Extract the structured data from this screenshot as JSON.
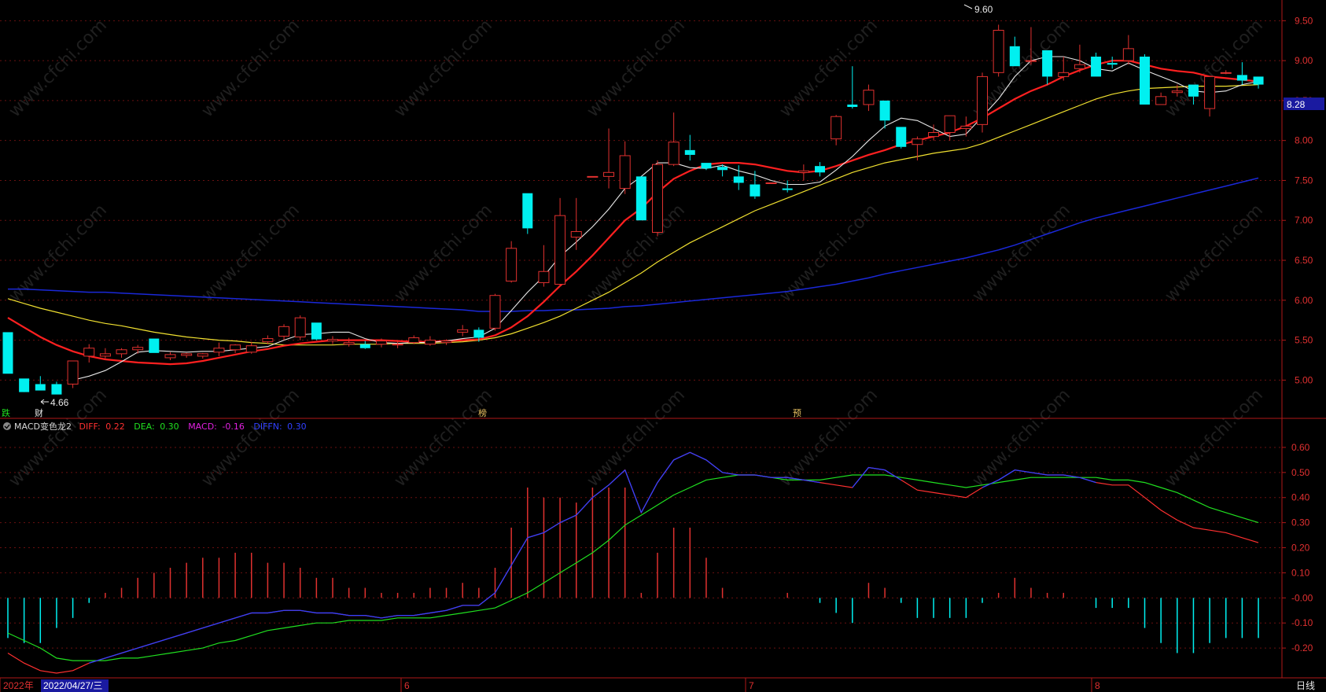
{
  "chart_data": {
    "type": "candlestick",
    "timeframe_label": "日线",
    "colors": {
      "up": "#e0312f",
      "down": "#00f0f0",
      "ma5": "#e8e8e8",
      "ma10": "#ff2020",
      "ma20": "#f0e030",
      "ma60": "#1a28d8",
      "diff": "#ff3030",
      "dea": "#20e020",
      "macd_label": "#e020e0",
      "diffn": "#3040ff",
      "axis": "#b01818",
      "price_box": "#1a1aa0"
    },
    "price_axis": {
      "ylim": [
        4.6,
        9.7
      ],
      "ticks": [
        "9.50",
        "9.00",
        "8.50",
        "8.00",
        "7.50",
        "7.00",
        "6.50",
        "6.00",
        "5.50",
        "5.00"
      ]
    },
    "macd_axis": {
      "ylim": [
        -0.3,
        0.65
      ],
      "ticks": [
        "0.60",
        "0.50",
        "0.40",
        "0.30",
        "0.20",
        "0.10",
        "-0.00",
        "-0.10",
        "-0.20"
      ]
    },
    "current_price": "8.28",
    "annotations": {
      "high": "9.60",
      "low": "4.66"
    },
    "markers": [
      "跌",
      "财",
      "榜",
      "预"
    ],
    "x_labels": {
      "year": "2022年",
      "cursor_date": "2022/04/27/三",
      "months": [
        "6",
        "7",
        "8"
      ]
    },
    "indicator": {
      "name": "MACD变色龙2",
      "fields": [
        {
          "label": "DIFF:",
          "value": "0.22"
        },
        {
          "label": "DEA:",
          "value": "0.30"
        },
        {
          "label": "MACD:",
          "value": "-0.16"
        },
        {
          "label": "DIFFN:",
          "value": "0.30"
        }
      ]
    },
    "watermark": "www.cfchi.com",
    "candles": [
      [
        5.6,
        5.6,
        5.08,
        5.08
      ],
      [
        5.02,
        5.02,
        4.9,
        4.85
      ],
      [
        4.95,
        5.05,
        4.87,
        4.87
      ],
      [
        4.95,
        4.98,
        4.82,
        4.82
      ],
      [
        4.95,
        5.24,
        4.9,
        5.24
      ],
      [
        5.3,
        5.45,
        5.22,
        5.4
      ],
      [
        5.3,
        5.4,
        5.27,
        5.33
      ],
      [
        5.33,
        5.4,
        5.28,
        5.38
      ],
      [
        5.38,
        5.44,
        5.33,
        5.41
      ],
      [
        5.52,
        5.52,
        5.34,
        5.34
      ],
      [
        5.28,
        5.35,
        5.25,
        5.32
      ],
      [
        5.31,
        5.34,
        5.28,
        5.33
      ],
      [
        5.3,
        5.34,
        5.27,
        5.33
      ],
      [
        5.35,
        5.47,
        5.3,
        5.4
      ],
      [
        5.38,
        5.45,
        5.34,
        5.44
      ],
      [
        5.35,
        5.48,
        5.33,
        5.43
      ],
      [
        5.48,
        5.56,
        5.45,
        5.52
      ],
      [
        5.55,
        5.7,
        5.5,
        5.67
      ],
      [
        5.54,
        5.81,
        5.5,
        5.78
      ],
      [
        5.72,
        5.72,
        5.5,
        5.51
      ],
      [
        5.49,
        5.55,
        5.45,
        5.51
      ],
      [
        5.45,
        5.53,
        5.42,
        5.47
      ],
      [
        5.45,
        5.49,
        5.39,
        5.4
      ],
      [
        5.45,
        5.52,
        5.41,
        5.49
      ],
      [
        5.45,
        5.5,
        5.4,
        5.45
      ],
      [
        5.47,
        5.56,
        5.45,
        5.53
      ],
      [
        5.45,
        5.55,
        5.43,
        5.5
      ],
      [
        5.47,
        5.51,
        5.44,
        5.49
      ],
      [
        5.6,
        5.69,
        5.55,
        5.63
      ],
      [
        5.63,
        5.66,
        5.48,
        5.53
      ],
      [
        5.65,
        6.08,
        5.62,
        6.06
      ],
      [
        6.24,
        6.74,
        6.22,
        6.65
      ],
      [
        7.34,
        7.34,
        6.83,
        6.9
      ],
      [
        6.22,
        6.69,
        6.17,
        6.36
      ],
      [
        6.2,
        7.28,
        6.18,
        7.06
      ],
      [
        6.79,
        7.28,
        6.63,
        6.86
      ],
      [
        7.55,
        7.55,
        7.55,
        7.55
      ],
      [
        7.55,
        8.15,
        7.4,
        7.6
      ],
      [
        7.4,
        7.99,
        7.33,
        7.81
      ],
      [
        7.55,
        7.55,
        7.0,
        7.0
      ],
      [
        6.85,
        7.75,
        6.8,
        7.7
      ],
      [
        7.7,
        8.35,
        7.68,
        7.98
      ],
      [
        7.88,
        8.07,
        7.75,
        7.82
      ],
      [
        7.72,
        7.72,
        7.63,
        7.65
      ],
      [
        7.67,
        7.7,
        7.55,
        7.63
      ],
      [
        7.55,
        7.69,
        7.38,
        7.47
      ],
      [
        7.45,
        7.62,
        7.27,
        7.3
      ],
      [
        7.47,
        7.47,
        7.47,
        7.47
      ],
      [
        7.4,
        7.5,
        7.35,
        7.38
      ],
      [
        7.6,
        7.7,
        7.5,
        7.62
      ],
      [
        7.68,
        7.73,
        7.55,
        7.6
      ],
      [
        8.02,
        8.32,
        7.94,
        8.3
      ],
      [
        8.45,
        8.93,
        8.4,
        8.42
      ],
      [
        8.45,
        8.7,
        8.37,
        8.63
      ],
      [
        8.5,
        8.5,
        8.15,
        8.25
      ],
      [
        8.17,
        8.17,
        7.9,
        7.92
      ],
      [
        7.95,
        8.05,
        7.75,
        8.02
      ],
      [
        8.05,
        8.2,
        8.0,
        8.1
      ],
      [
        8.1,
        8.31,
        8.0,
        8.31
      ],
      [
        8.15,
        8.3,
        8.05,
        8.18
      ],
      [
        8.2,
        8.85,
        8.1,
        8.8
      ],
      [
        8.85,
        9.45,
        8.8,
        9.38
      ],
      [
        9.18,
        9.3,
        8.93,
        8.93
      ],
      [
        9.0,
        9.42,
        8.95,
        9.0
      ],
      [
        9.13,
        9.13,
        8.7,
        8.8
      ],
      [
        8.8,
        9.05,
        8.75,
        8.85
      ],
      [
        8.9,
        9.2,
        8.85,
        8.95
      ],
      [
        9.05,
        9.1,
        8.8,
        8.8
      ],
      [
        8.97,
        9.05,
        8.9,
        8.95
      ],
      [
        9.0,
        9.32,
        8.95,
        9.15
      ],
      [
        9.05,
        9.08,
        8.45,
        8.45
      ],
      [
        8.45,
        8.6,
        8.45,
        8.55
      ],
      [
        8.6,
        8.7,
        8.55,
        8.62
      ],
      [
        8.7,
        8.7,
        8.45,
        8.55
      ],
      [
        8.4,
        8.8,
        8.3,
        8.8
      ],
      [
        8.85,
        8.88,
        8.83,
        8.85
      ],
      [
        8.82,
        8.98,
        8.7,
        8.75
      ],
      [
        8.8,
        8.8,
        8.65,
        8.7
      ]
    ],
    "ma5": [
      null,
      null,
      null,
      null,
      5.0,
      5.05,
      5.12,
      5.23,
      5.35,
      5.37,
      5.36,
      5.35,
      5.36,
      5.36,
      5.38,
      5.4,
      5.42,
      5.5,
      5.57,
      5.58,
      5.6,
      5.6,
      5.52,
      5.47,
      5.46,
      5.47,
      5.47,
      5.49,
      5.52,
      5.54,
      5.65,
      5.87,
      6.1,
      6.3,
      6.55,
      6.73,
      6.92,
      7.14,
      7.4,
      7.55,
      7.72,
      7.72,
      7.66,
      7.65,
      7.69,
      7.62,
      7.57,
      7.5,
      7.45,
      7.45,
      7.48,
      7.63,
      7.8,
      8.0,
      8.18,
      8.28,
      8.25,
      8.15,
      8.05,
      8.08,
      8.3,
      8.52,
      8.8,
      9.0,
      9.05,
      9.05,
      9.0,
      8.9,
      8.87,
      8.97,
      8.88,
      8.8,
      8.72,
      8.62,
      8.6,
      8.62,
      8.7,
      8.74
    ],
    "ma10": [
      5.78,
      5.66,
      5.54,
      5.44,
      5.36,
      5.3,
      5.26,
      5.24,
      5.22,
      5.21,
      5.2,
      5.21,
      5.24,
      5.28,
      5.32,
      5.36,
      5.39,
      5.43,
      5.46,
      5.48,
      5.5,
      5.5,
      5.5,
      5.5,
      5.49,
      5.48,
      5.48,
      5.49,
      5.5,
      5.51,
      5.56,
      5.66,
      5.8,
      5.98,
      6.18,
      6.36,
      6.56,
      6.78,
      7.0,
      7.15,
      7.35,
      7.52,
      7.62,
      7.7,
      7.72,
      7.72,
      7.7,
      7.66,
      7.62,
      7.6,
      7.62,
      7.68,
      7.75,
      7.82,
      7.88,
      7.95,
      8.0,
      8.05,
      8.1,
      8.18,
      8.28,
      8.4,
      8.52,
      8.62,
      8.7,
      8.8,
      8.88,
      8.95,
      9.0,
      9.0,
      8.95,
      8.9,
      8.87,
      8.85,
      8.8,
      8.78,
      8.76,
      8.74
    ],
    "ma20": [
      6.02,
      5.96,
      5.9,
      5.85,
      5.8,
      5.75,
      5.71,
      5.68,
      5.64,
      5.6,
      5.57,
      5.54,
      5.52,
      5.5,
      5.49,
      5.47,
      5.46,
      5.44,
      5.44,
      5.44,
      5.44,
      5.45,
      5.45,
      5.45,
      5.46,
      5.46,
      5.46,
      5.47,
      5.48,
      5.5,
      5.53,
      5.58,
      5.65,
      5.72,
      5.8,
      5.9,
      6.0,
      6.1,
      6.22,
      6.34,
      6.48,
      6.6,
      6.72,
      6.82,
      6.92,
      7.02,
      7.12,
      7.2,
      7.28,
      7.36,
      7.44,
      7.52,
      7.6,
      7.66,
      7.72,
      7.76,
      7.8,
      7.84,
      7.87,
      7.9,
      7.96,
      8.04,
      8.12,
      8.2,
      8.28,
      8.36,
      8.44,
      8.52,
      8.58,
      8.62,
      8.65,
      8.66,
      8.67,
      8.68,
      8.68,
      8.68,
      8.69,
      8.7
    ],
    "ma60": [
      6.14,
      6.14,
      6.13,
      6.12,
      6.11,
      6.1,
      6.1,
      6.09,
      6.08,
      6.07,
      6.06,
      6.05,
      6.04,
      6.03,
      6.02,
      6.01,
      6.0,
      5.99,
      5.98,
      5.97,
      5.96,
      5.95,
      5.94,
      5.93,
      5.92,
      5.91,
      5.9,
      5.89,
      5.88,
      5.86,
      5.86,
      5.86,
      5.87,
      5.87,
      5.88,
      5.88,
      5.89,
      5.9,
      5.92,
      5.93,
      5.95,
      5.97,
      5.99,
      6.01,
      6.03,
      6.05,
      6.07,
      6.09,
      6.11,
      6.14,
      6.17,
      6.2,
      6.24,
      6.28,
      6.33,
      6.37,
      6.41,
      6.45,
      6.49,
      6.53,
      6.58,
      6.63,
      6.69,
      6.76,
      6.83,
      6.9,
      6.97,
      7.03,
      7.08,
      7.13,
      7.18,
      7.23,
      7.28,
      7.33,
      7.38,
      7.43,
      7.48,
      7.53
    ],
    "diff": [
      -0.22,
      -0.26,
      -0.29,
      -0.3,
      -0.29,
      -0.26,
      -0.24,
      -0.22,
      -0.2,
      -0.18,
      -0.16,
      -0.14,
      -0.12,
      -0.1,
      -0.08,
      -0.06,
      -0.06,
      -0.05,
      -0.05,
      -0.06,
      -0.06,
      -0.07,
      -0.07,
      -0.08,
      -0.07,
      -0.07,
      -0.06,
      -0.05,
      -0.03,
      -0.03,
      0.02,
      0.13,
      0.24,
      0.26,
      0.3,
      0.33,
      0.4,
      0.45,
      0.51,
      0.34,
      0.46,
      0.55,
      0.58,
      0.55,
      0.5,
      0.49,
      0.49,
      0.48,
      0.48,
      0.47,
      0.46,
      0.45,
      0.44,
      0.52,
      0.51,
      0.47,
      0.43,
      0.42,
      0.41,
      0.4,
      0.44,
      0.47,
      0.51,
      0.5,
      0.49,
      0.49,
      0.48,
      0.46,
      0.45,
      0.45,
      0.4,
      0.35,
      0.31,
      0.28,
      0.27,
      0.26,
      0.24,
      0.22
    ],
    "dea": [
      -0.14,
      -0.17,
      -0.2,
      -0.24,
      -0.25,
      -0.25,
      -0.25,
      -0.24,
      -0.24,
      -0.23,
      -0.22,
      -0.21,
      -0.2,
      -0.18,
      -0.17,
      -0.15,
      -0.13,
      -0.12,
      -0.11,
      -0.1,
      -0.1,
      -0.09,
      -0.09,
      -0.09,
      -0.08,
      -0.08,
      -0.08,
      -0.07,
      -0.06,
      -0.05,
      -0.04,
      -0.01,
      0.02,
      0.06,
      0.1,
      0.14,
      0.18,
      0.23,
      0.29,
      0.33,
      0.37,
      0.41,
      0.44,
      0.47,
      0.48,
      0.49,
      0.49,
      0.48,
      0.47,
      0.47,
      0.47,
      0.48,
      0.49,
      0.49,
      0.49,
      0.48,
      0.47,
      0.46,
      0.45,
      0.44,
      0.45,
      0.46,
      0.47,
      0.48,
      0.48,
      0.48,
      0.48,
      0.48,
      0.47,
      0.47,
      0.46,
      0.44,
      0.42,
      0.39,
      0.36,
      0.34,
      0.32,
      0.3
    ]
  }
}
